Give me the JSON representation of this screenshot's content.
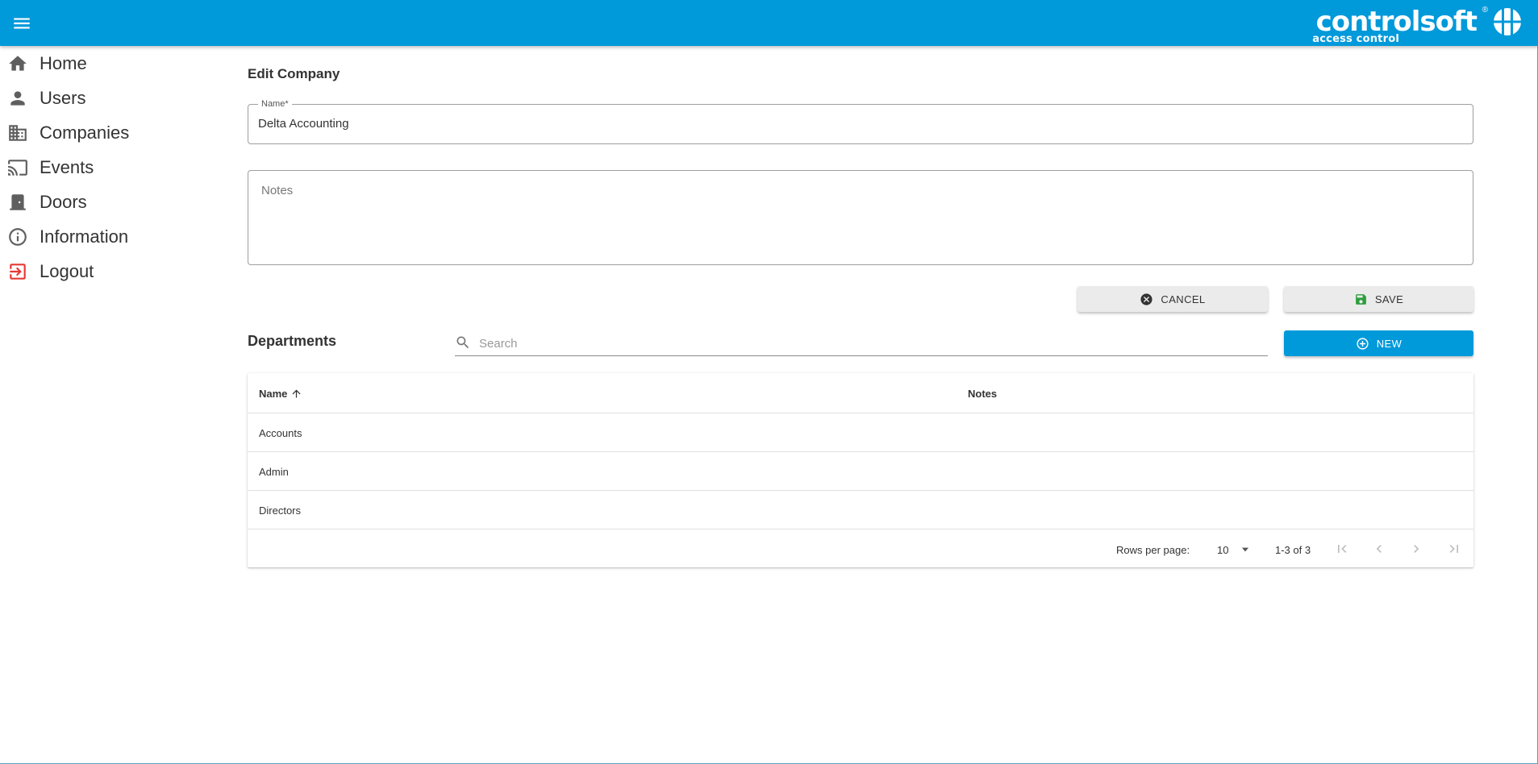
{
  "topbar": {
    "menu_icon": "menu-icon",
    "brand": {
      "name": "controlsoft",
      "tagline": "access control",
      "registered": "®"
    }
  },
  "sidebar": {
    "items": [
      {
        "label": "Home",
        "icon": "home-icon"
      },
      {
        "label": "Users",
        "icon": "person-icon"
      },
      {
        "label": "Companies",
        "icon": "business-icon"
      },
      {
        "label": "Events",
        "icon": "cast-icon"
      },
      {
        "label": "Doors",
        "icon": "door-icon"
      },
      {
        "label": "Information",
        "icon": "info-icon"
      },
      {
        "label": "Logout",
        "icon": "logout-icon",
        "color": "#e53935"
      }
    ]
  },
  "form": {
    "title": "Edit Company",
    "name_label": "Name*",
    "name_value": "Delta Accounting",
    "notes_placeholder": "Notes",
    "cancel_label": "CANCEL",
    "save_label": "SAVE"
  },
  "departments": {
    "title": "Departments",
    "search_placeholder": "Search",
    "new_label": "NEW",
    "columns": {
      "name": "Name",
      "notes": "Notes"
    },
    "sort": {
      "column": "name",
      "direction": "ascending"
    },
    "rows": [
      {
        "name": "Accounts",
        "notes": ""
      },
      {
        "name": "Admin",
        "notes": ""
      },
      {
        "name": "Directors",
        "notes": ""
      }
    ],
    "pagination": {
      "rows_per_page_label": "Rows per page:",
      "rows_per_page": "10",
      "range": "1-3 of 3"
    }
  },
  "colors": {
    "primary": "#0099da",
    "save_icon": "#2e7d32",
    "logout": "#e53935"
  }
}
